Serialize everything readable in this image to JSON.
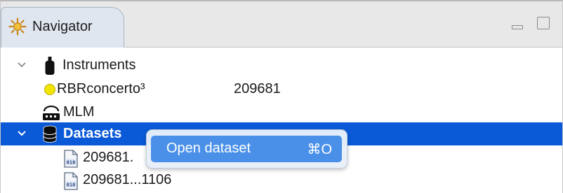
{
  "panel": {
    "tab_title": "Navigator",
    "icons": {
      "tab": "navigator-sun-icon",
      "minimize": "minimize-icon",
      "maximize": "maximize-icon"
    }
  },
  "tree": {
    "instruments": {
      "label": "Instruments",
      "icon": "instrument-icon",
      "expanded": true
    },
    "instrument_device": {
      "name": "RBRconcerto³",
      "serial": "209681",
      "status_color": "#f2e600",
      "icon": "status-dot-icon"
    },
    "mlm": {
      "label": "MLM",
      "icon": "mlm-icon"
    },
    "datasets": {
      "label": "Datasets",
      "icon": "database-icon",
      "expanded": true,
      "selected": true
    },
    "dataset_files": [
      {
        "label": "209681.",
        "icon": "binary-file-icon"
      },
      {
        "label": "209681...1106",
        "icon": "binary-file-icon"
      }
    ]
  },
  "context_menu": {
    "items": [
      {
        "label": "Open dataset",
        "shortcut": "⌘O",
        "highlighted": true
      }
    ]
  },
  "colors": {
    "selection": "#0a5ad8",
    "menu_highlight": "#4a90e9"
  }
}
